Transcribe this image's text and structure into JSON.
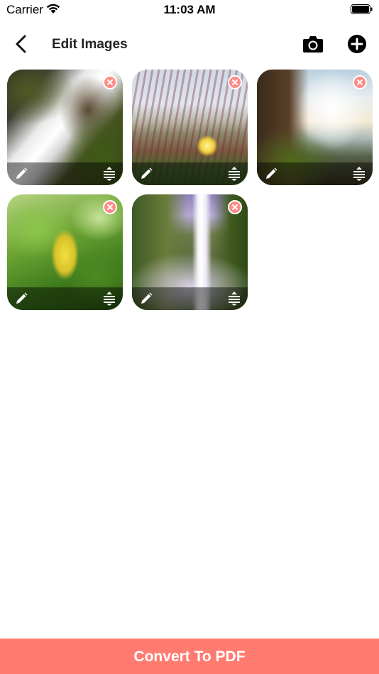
{
  "status_bar": {
    "carrier": "Carrier",
    "time": "11:03 AM"
  },
  "nav": {
    "title": "Edit Images",
    "back_icon": "chevron-left-icon",
    "camera_icon": "camera-icon",
    "add_icon": "plus-circle-icon"
  },
  "images": [
    {
      "subject": "waterfall over mossy rocks"
    },
    {
      "subject": "grass and yellow flower"
    },
    {
      "subject": "waterfall and rocky coast"
    },
    {
      "subject": "green leaves with yellow leaf"
    },
    {
      "subject": "tall waterfall in misty canyon"
    }
  ],
  "tile_icons": {
    "edit": "pencil-icon",
    "reorder": "reorder-icon",
    "remove": "remove-icon"
  },
  "colors": {
    "accent": "#ff7b70",
    "remove": "#ff8a85"
  },
  "footer": {
    "convert_label": "Convert To PDF"
  }
}
